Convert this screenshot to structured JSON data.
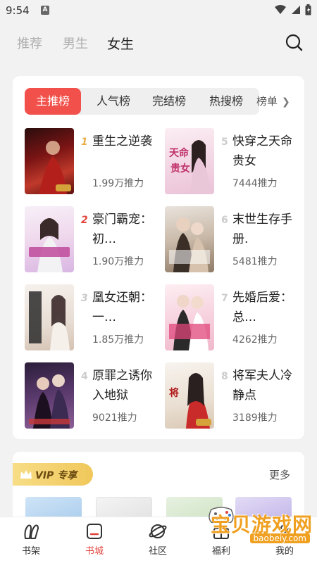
{
  "status_bar": {
    "time": "9:54",
    "notif_letter": "A"
  },
  "header": {
    "tabs": [
      {
        "label": "推荐",
        "active": false
      },
      {
        "label": "男生",
        "active": false
      },
      {
        "label": "女生",
        "active": true
      }
    ]
  },
  "rank": {
    "tabs": [
      "主推榜",
      "人气榜",
      "完结榜",
      "热搜榜"
    ],
    "more_label": "榜单",
    "books": [
      {
        "rank": "1",
        "title": "重生之逆袭",
        "votes": "1.99万推力"
      },
      {
        "rank": "2",
        "title": "豪门霸宠：初…",
        "votes": "1.90万推力"
      },
      {
        "rank": "3",
        "title": "凰女还朝：一…",
        "votes": "1.85万推力"
      },
      {
        "rank": "4",
        "title": "原罪之诱你入地狱",
        "votes": "9021推力"
      },
      {
        "rank": "5",
        "title": "快穿之天命贵女",
        "votes": "7444推力"
      },
      {
        "rank": "6",
        "title": "末世生存手册.",
        "votes": "5481推力"
      },
      {
        "rank": "7",
        "title": "先婚后爱：总…",
        "votes": "4262推力"
      },
      {
        "rank": "8",
        "title": "将军夫人冷静点",
        "votes": "3189推力"
      }
    ]
  },
  "vip": {
    "badge": "VIP 专享",
    "more": "更多"
  },
  "bottom_nav": [
    {
      "label": "书架",
      "icon": "bookshelf-icon"
    },
    {
      "label": "书城",
      "icon": "bookstore-icon",
      "active": true
    },
    {
      "label": "社区",
      "icon": "community-icon"
    },
    {
      "label": "福利",
      "icon": "gift-icon"
    },
    {
      "label": "我的",
      "icon": "profile-icon"
    }
  ],
  "watermark": {
    "text": "宝贝游戏网",
    "url": "baobeiy.com"
  },
  "colors": {
    "accent": "#f2504b",
    "vip_gold": "#f0c75b"
  }
}
